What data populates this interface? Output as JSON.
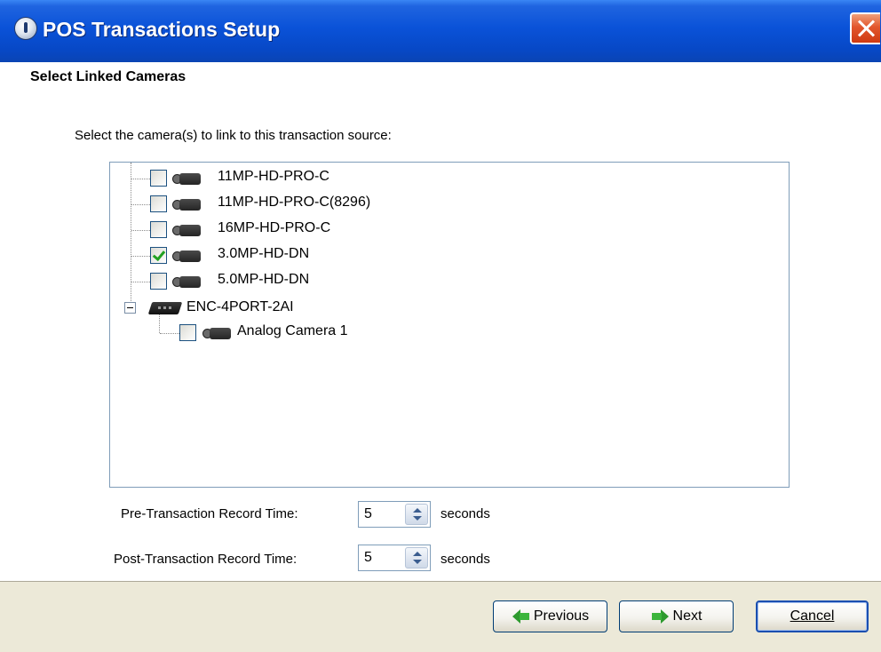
{
  "window": {
    "title": "POS Transactions Setup",
    "icons": {
      "app": "app-icon",
      "close": "close-icon"
    }
  },
  "page": {
    "heading": "Select Linked Cameras",
    "instruction": "Select the camera(s) to link to this transaction source:"
  },
  "tree": {
    "items": [
      {
        "label": "11MP-HD-PRO-C",
        "checked": false,
        "icon": "camera-icon"
      },
      {
        "label": "11MP-HD-PRO-C(8296)",
        "checked": false,
        "icon": "camera-icon"
      },
      {
        "label": "16MP-HD-PRO-C",
        "checked": false,
        "icon": "camera-icon"
      },
      {
        "label": "3.0MP-HD-DN",
        "checked": true,
        "icon": "camera-icon"
      },
      {
        "label": "5.0MP-HD-DN",
        "checked": false,
        "icon": "camera-icon"
      },
      {
        "label": "ENC-4PORT-2AI",
        "expanded": true,
        "icon": "encoder-icon",
        "children": [
          {
            "label": "Analog Camera 1",
            "checked": false,
            "icon": "camera-icon"
          }
        ]
      }
    ]
  },
  "record": {
    "pre_label": "Pre-Transaction Record Time:",
    "pre_value": "5",
    "post_label": "Post-Transaction Record Time:",
    "post_value": "5",
    "unit": "seconds"
  },
  "buttons": {
    "previous": "Previous",
    "next": "Next",
    "cancel": "Cancel"
  },
  "colors": {
    "titlebar": "#0a52d8",
    "close": "#e2562c",
    "check": "#21a121",
    "footer": "#ece9d8"
  }
}
